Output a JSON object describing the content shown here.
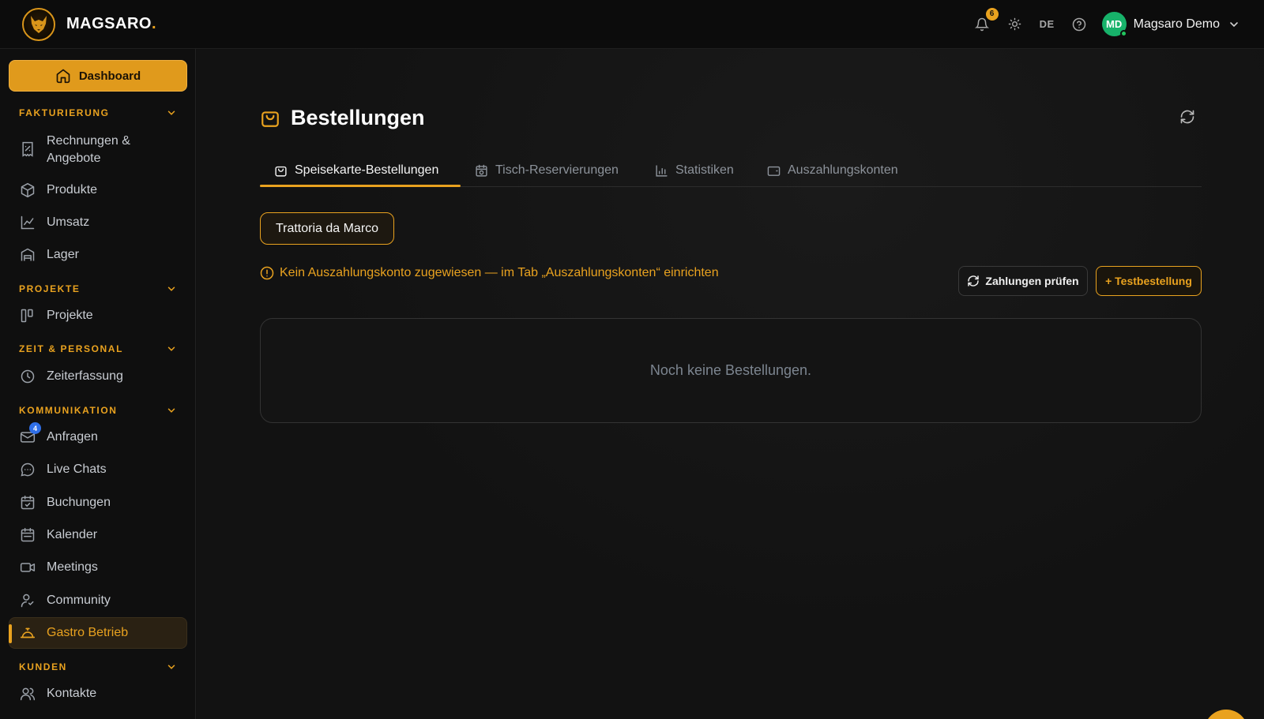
{
  "brand": {
    "name": "MAGSARO",
    "dot": "."
  },
  "topbar": {
    "notification_count": "6",
    "language": "DE",
    "user": {
      "initials": "MD",
      "name": "Magsaro Demo"
    }
  },
  "sidebar": {
    "dashboard_label": "Dashboard",
    "sections": [
      {
        "title": "FAKTURIERUNG",
        "items": [
          {
            "label": "Rechnungen &",
            "label2": "Angebote"
          },
          {
            "label": "Produkte"
          },
          {
            "label": "Umsatz"
          },
          {
            "label": "Lager"
          }
        ]
      },
      {
        "title": "PROJEKTE",
        "items": [
          {
            "label": "Projekte"
          }
        ]
      },
      {
        "title": "ZEIT & PERSONAL",
        "items": [
          {
            "label": "Zeiterfassung"
          }
        ]
      },
      {
        "title": "KOMMUNIKATION",
        "items": [
          {
            "label": "Anfragen",
            "badge": "4"
          },
          {
            "label": "Live Chats"
          },
          {
            "label": "Buchungen"
          },
          {
            "label": "Kalender"
          },
          {
            "label": "Meetings"
          },
          {
            "label": "Community"
          },
          {
            "label": "Gastro Betrieb",
            "active": true
          }
        ]
      },
      {
        "title": "KUNDEN",
        "items": [
          {
            "label": "Kontakte"
          }
        ]
      }
    ]
  },
  "main": {
    "title": "Bestellungen",
    "tabs": [
      {
        "label": "Speisekarte-Bestellungen",
        "active": true
      },
      {
        "label": "Tisch-Reservierungen"
      },
      {
        "label": "Statistiken"
      },
      {
        "label": "Auszahlungskonten"
      }
    ],
    "restaurant_chip": "Trattoria da Marco",
    "warning": "Kein Auszahlungskonto zugewiesen — im Tab „Auszahlungskonten“ einrichten",
    "check_payments_label": "Zahlungen prüfen",
    "test_order_label": "+ Testbestellung",
    "empty_message": "Noch keine Bestellungen."
  },
  "colors": {
    "accent": "#e9a21f",
    "avatar": "#17b26a",
    "badge_blue": "#2f6fe8"
  },
  "icons": [
    "wolf-logo-icon",
    "bell-icon",
    "sun-icon",
    "help-icon",
    "chevron-down-icon",
    "home-icon",
    "receipt-icon",
    "box-icon",
    "chart-line-icon",
    "warehouse-icon",
    "kanban-icon",
    "clock-icon",
    "mail-icon",
    "chat-icon",
    "calendar-check-icon",
    "calendar-icon",
    "video-icon",
    "community-icon",
    "service-bell-icon",
    "users-icon",
    "shopping-bag-icon",
    "refresh-icon",
    "calendar-clock-icon",
    "bar-chart-icon",
    "wallet-icon",
    "alert-circle-icon"
  ]
}
